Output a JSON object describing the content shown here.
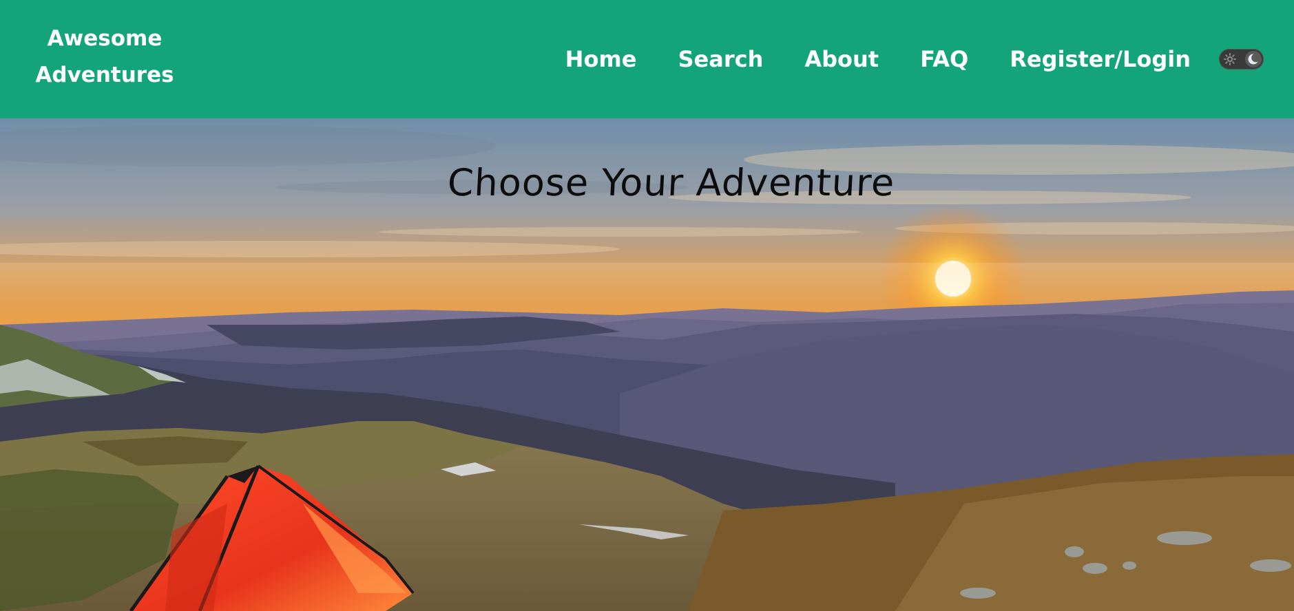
{
  "navbar": {
    "brand_line1": "Awesome",
    "brand_line2": "Adventures",
    "links": [
      {
        "label": "Home"
      },
      {
        "label": "Search"
      },
      {
        "label": "About"
      },
      {
        "label": "FAQ"
      },
      {
        "label": "Register/Login"
      }
    ],
    "theme_toggle": {
      "state": "dark",
      "left_icon": "sun-gear-icon",
      "right_icon": "moon-icon"
    },
    "background_color": "#13a47a"
  },
  "hero": {
    "title": "Choose Your Adventure",
    "image": "sunset-mountains-tent-photo"
  }
}
